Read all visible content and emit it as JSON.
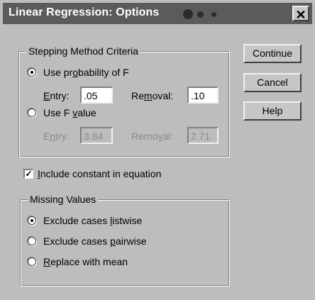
{
  "window": {
    "title": "Linear Regression: Options",
    "close_glyph": "✕"
  },
  "stepping": {
    "legend": "Stepping Method Criteria",
    "use_probability": {
      "label_pre": "Use pr",
      "label_mnemonic": "o",
      "label_post": "bability of F",
      "selected": true
    },
    "prob_entry": {
      "label_mnemonic": "E",
      "label_post": "ntry:",
      "value": ".05"
    },
    "prob_removal": {
      "label_pre": "Re",
      "label_mnemonic": "m",
      "label_post": "oval:",
      "value": ".10"
    },
    "use_f_value": {
      "label_pre": "Use F ",
      "label_mnemonic": "v",
      "label_post": "alue",
      "selected": false
    },
    "f_entry": {
      "label_pre": "E",
      "label_mnemonic": "n",
      "label_post": "try:",
      "value": "3.84"
    },
    "f_removal": {
      "label_pre": "Remo",
      "label_mnemonic": "v",
      "label_post": "al:",
      "value": "2.71"
    }
  },
  "include_constant": {
    "label_mnemonic": "I",
    "label_post": "nclude constant in equation",
    "checked": true,
    "check_glyph": "✓"
  },
  "missing": {
    "legend": "Missing Values",
    "listwise": {
      "label_pre": "Exclude cases ",
      "label_mnemonic": "l",
      "label_post": "istwise",
      "selected": true
    },
    "pairwise": {
      "label_pre": "Exclude cases ",
      "label_mnemonic": "p",
      "label_post": "airwise",
      "selected": false
    },
    "replace": {
      "label_mnemonic": "R",
      "label_post": "eplace with mean",
      "selected": false
    }
  },
  "buttons": {
    "continue": "Continue",
    "cancel": "Cancel",
    "help": "Help"
  }
}
